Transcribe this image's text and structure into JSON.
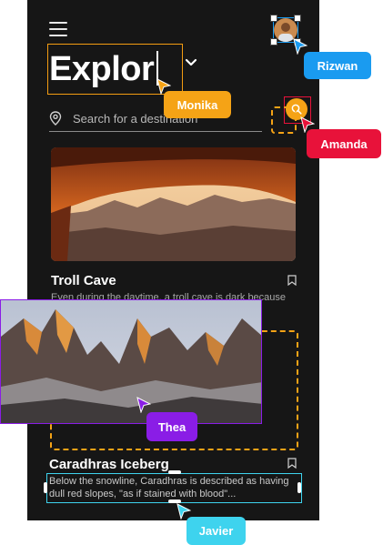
{
  "app": {
    "title": "Explor",
    "search_placeholder": "Search for a destination"
  },
  "cards": [
    {
      "title": "Troll Cave",
      "description": "Even during the daytime, a troll cave is dark because ... the ..."
    },
    {
      "title": "Caradhras Iceberg",
      "description": "Below the snowline, Caradhras is described as having dull red slopes, \"as if stained with blood\"..."
    }
  ],
  "collaborators": [
    {
      "name": "Rizwan",
      "color": "#1a9bf0"
    },
    {
      "name": "Monika",
      "color": "#f5a316"
    },
    {
      "name": "Amanda",
      "color": "#e8123a"
    },
    {
      "name": "Thea",
      "color": "#8a1de6"
    },
    {
      "name": "Javier",
      "color": "#3ed3ee"
    }
  ],
  "icons": [
    "menu-icon",
    "avatar",
    "chevron-down-icon",
    "location-pin-icon",
    "search-icon",
    "bookmark-icon",
    "cursor-arrow-icon"
  ]
}
